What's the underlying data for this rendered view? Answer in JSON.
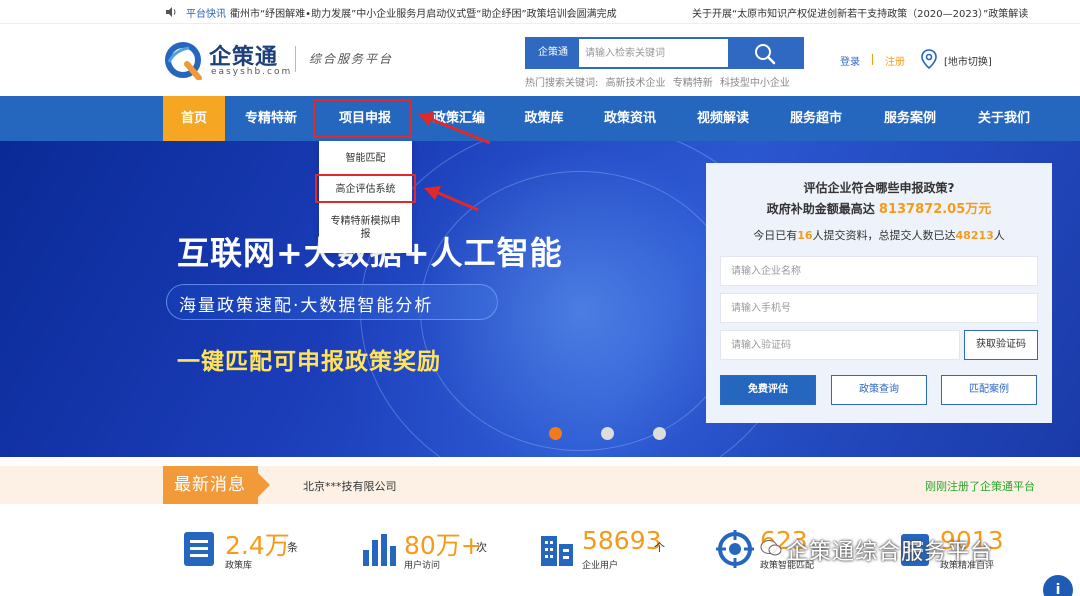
{
  "notice": {
    "label": "平台快讯",
    "message": "衢州市“纾困解难•助力发展”中小企业服务月启动仪式暨“助企纾困”政策培训会圆满完成",
    "message2": "关于开展“太原市知识产权促进创新若干支持政策（2020—2023）”政策解读"
  },
  "header": {
    "logo_name": "企策通",
    "logo_domain": "easyshb.com",
    "slogan": "综合服务平台",
    "search_tag": "企策通",
    "search_placeholder": "请输入检索关键词",
    "hot_label": "热门搜索关键词:",
    "hot_keywords": [
      "高新技术企业",
      "专精特新",
      "科技型中小企业"
    ],
    "login": "登录",
    "register": "注册",
    "city_switch": "[地市切换]"
  },
  "nav": {
    "items": [
      "首页",
      "专精特新",
      "项目申报",
      "政策汇编",
      "政策库",
      "政策资讯",
      "视频解读",
      "服务超市",
      "服务案例",
      "关于我们"
    ]
  },
  "dropdown": {
    "items": [
      "智能匹配",
      "高企评估系统",
      "专精特新模拟申报"
    ]
  },
  "banner": {
    "headline": "互联网+大数据+人工智能",
    "pill": "海量政策速配·大数据智能分析",
    "slogan": "一键匹配可申报政策奖励",
    "active_slide": 1,
    "slide_count": 3
  },
  "panel": {
    "question": "评估企业符合哪些申报政策?",
    "subsidy_prefix": "政府补助金额最高达",
    "subsidy_amount": "8137872.05万元",
    "today_prefix": "今日已有",
    "today_count": "16",
    "today_middle": "人提交资料，总提交人数已达",
    "total_count": "48213",
    "today_suffix": "人",
    "company_placeholder": "请输入企业名称",
    "phone_placeholder": "请输入手机号",
    "code_placeholder": "请输入验证码",
    "code_button": "获取验证码",
    "free_button": "免费评估",
    "policy_button": "政策查询",
    "case_button": "匹配案例"
  },
  "news": {
    "tag": "最新消息",
    "company": "北京***技有限公司",
    "registered": "刚刚注册了企策通平台"
  },
  "stats": [
    {
      "num": "2.4万",
      "unit": "条",
      "label": "政策库"
    },
    {
      "num": "80万+",
      "unit": "次",
      "label": "用户访问"
    },
    {
      "num": "58693",
      "unit": "个",
      "label": "企业用户"
    },
    {
      "num": "623",
      "unit": "",
      "label": "政策智能匹配"
    },
    {
      "num": "9013",
      "unit": "",
      "label": "政策精准自评"
    }
  ],
  "watermark": "企策通综合服务平台",
  "colors": {
    "brand_blue": "#2566bf",
    "accent_orange": "#f5a623",
    "highlight_red": "#e02a2a"
  }
}
